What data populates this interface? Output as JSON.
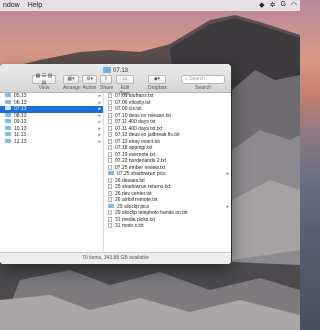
{
  "menubar": {
    "items": [
      "ndow",
      "Help"
    ],
    "right_icons": [
      "dropbox-icon",
      "settings-icon",
      "G",
      "wifi-icon"
    ]
  },
  "window": {
    "title": "07.13",
    "toolbar": {
      "view_label": "View",
      "arrange_label": "Arrange",
      "action_label": "Action",
      "share_label": "Share",
      "edit_tags_label": "Edit Tags",
      "dropbox_label": "Dropbox",
      "search_placeholder": "Search",
      "search_label": "Search"
    },
    "folders": [
      {
        "label": "05.13",
        "selected": false
      },
      {
        "label": "06.13",
        "selected": false
      },
      {
        "label": "07.13",
        "selected": true
      },
      {
        "label": "08.13",
        "selected": false
      },
      {
        "label": "09.13",
        "selected": false
      },
      {
        "label": "10.13",
        "selected": false
      },
      {
        "label": "11.13",
        "selected": false
      },
      {
        "label": "12.13",
        "selected": false
      }
    ],
    "files": [
      {
        "label": "07.01 alufrans.txt",
        "kind": "doc"
      },
      {
        "label": "07.06 ellcelty.txt",
        "kind": "doc"
      },
      {
        "label": "07.09 cix.txt",
        "kind": "doc"
      },
      {
        "label": "07.10 deus ex release.txt",
        "kind": "doc"
      },
      {
        "label": "07.11 400 days txt",
        "kind": "doc"
      },
      {
        "label": "07.11 400 days txt.txt",
        "kind": "doc"
      },
      {
        "label": "07.12 deus ex jailbreak fix.txt",
        "kind": "doc"
      },
      {
        "label": "07.13 ebay exact.txt",
        "kind": "doc"
      },
      {
        "label": "07.18 appmgr.txt",
        "kind": "doc"
      },
      {
        "label": "07.19 evernote.txt",
        "kind": "doc"
      },
      {
        "label": "07.22 borderlands 2.txt",
        "kind": "doc"
      },
      {
        "label": "07.25 ember review.txt",
        "kind": "doc"
      },
      {
        "label": "07.25 shadowrun pics",
        "kind": "folder"
      },
      {
        "label": "26 desaex.txt",
        "kind": "doc"
      },
      {
        "label": "25 shadowrun returns.txt",
        "kind": "doc"
      },
      {
        "label": "26 dev center.txt",
        "kind": "doc"
      },
      {
        "label": "26 airfoil remote.txt",
        "kind": "doc"
      },
      {
        "label": "29 siloclip pics",
        "kind": "folder"
      },
      {
        "label": "29 siloclip telephoto hands on.txt",
        "kind": "doc"
      },
      {
        "label": "31 media picks.txt",
        "kind": "doc"
      },
      {
        "label": "31 moto x.txt",
        "kind": "doc"
      }
    ],
    "status_text": "70 items, 343.88 GB available"
  }
}
